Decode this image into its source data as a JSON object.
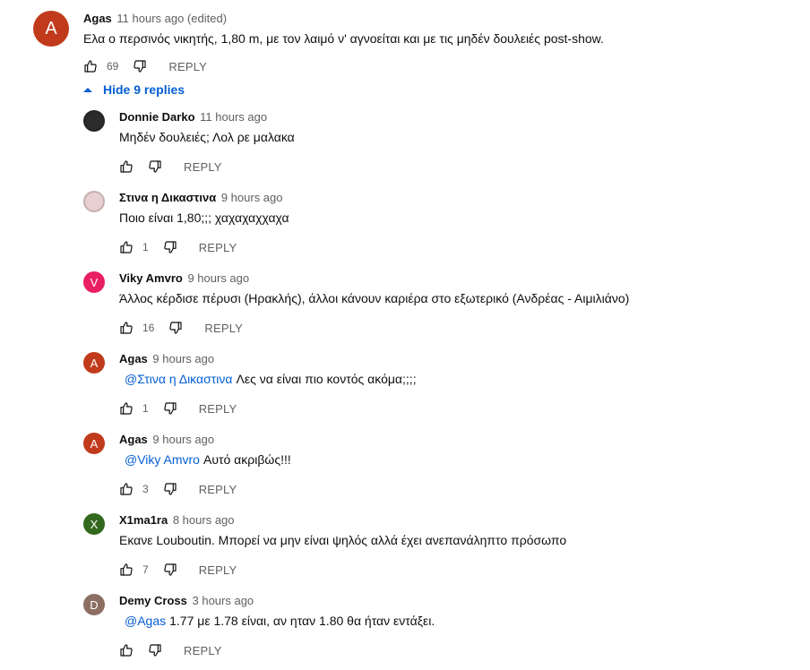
{
  "top_comment": {
    "avatar_letter": "A",
    "avatar_color": "#c03a1b",
    "author": "Agas",
    "time": "11 hours ago (edited)",
    "text": "Ελα ο περσινός νικητής, 1,80 m, με τον λαιμό ν' αγνοείται και με τις μηδέν δουλειές post-show.",
    "likes": "69",
    "reply_label": "REPLY"
  },
  "hide_replies_label": "Hide 9 replies",
  "replies": [
    {
      "avatar_letter": "",
      "avatar_color": "#2b2b2b",
      "author": "Donnie Darko",
      "time": "11 hours ago",
      "mention": "",
      "text": "Μηδέν δουλειές; Λολ ρε μαλακα",
      "likes": "",
      "reply_label": "REPLY"
    },
    {
      "avatar_letter": "",
      "avatar_color": "#e8cfd0",
      "author": "Στινα η Δικαστινα",
      "time": "9 hours ago",
      "mention": "",
      "text": "Ποιο είναι 1,80;;; χαχαχαχχαχα",
      "likes": "1",
      "reply_label": "REPLY"
    },
    {
      "avatar_letter": "V",
      "avatar_color": "#e91e63",
      "author": "Viky Amvro",
      "time": "9 hours ago",
      "mention": "",
      "text": "Άλλος κέρδισε πέρυσι (Ηρακλής), άλλοι κάνουν καριέρα στο εξωτερικό (Ανδρέας - Αιμιλιάνο)",
      "likes": "16",
      "reply_label": "REPLY"
    },
    {
      "avatar_letter": "A",
      "avatar_color": "#c03a1b",
      "author": "Agas",
      "time": "9 hours ago",
      "mention": "@Στινα η Δικαστινα",
      "text": "Λες να είναι πιο κοντός ακόμα;;;;",
      "likes": "1",
      "reply_label": "REPLY"
    },
    {
      "avatar_letter": "A",
      "avatar_color": "#c03a1b",
      "author": "Agas",
      "time": "9 hours ago",
      "mention": "@Viky Amvro",
      "text": "Αυτό ακριβώς!!!",
      "likes": "3",
      "reply_label": "REPLY"
    },
    {
      "avatar_letter": "X",
      "avatar_color": "#33691e",
      "author": "X1ma1ra",
      "time": "8 hours ago",
      "mention": "",
      "text": "Εκανε Louboutin. Μπορεί να μην είναι ψηλός αλλά έχει ανεπανάληπτο πρόσωπο",
      "likes": "7",
      "reply_label": "REPLY"
    },
    {
      "avatar_letter": "D",
      "avatar_color": "#8d6e63",
      "author": "Demy Cross",
      "time": "3 hours ago",
      "mention": "@Agas",
      "text": "1.77 με 1.78 είναι, αν ηταν 1.80 θα ήταν εντάξει.",
      "likes": "",
      "reply_label": "REPLY"
    }
  ]
}
